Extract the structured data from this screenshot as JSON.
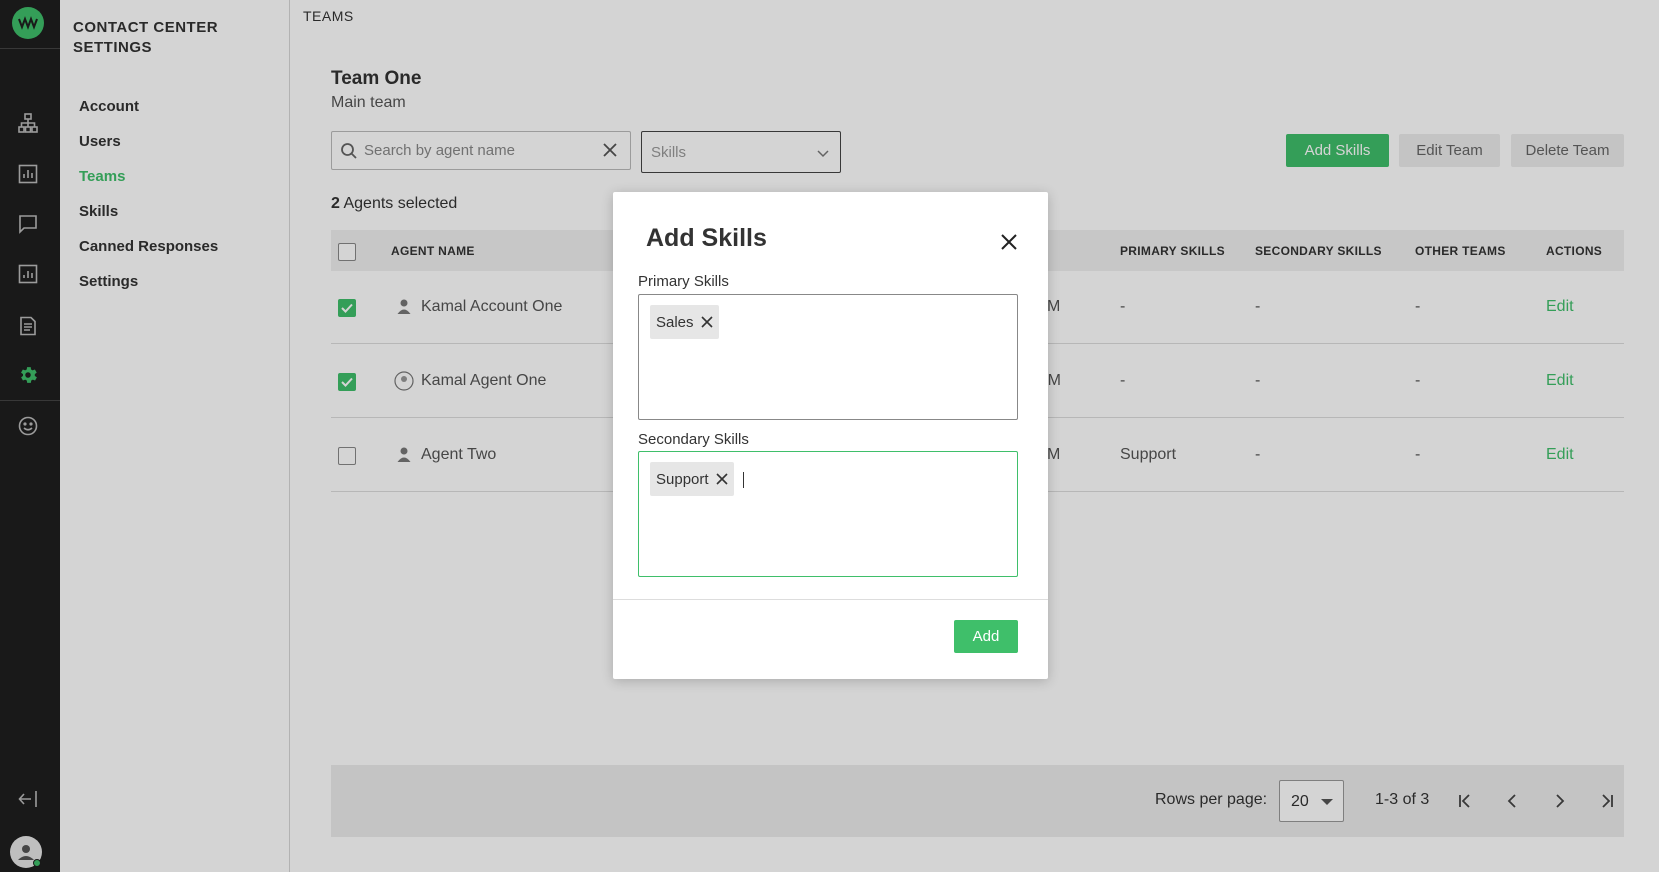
{
  "rail": {
    "icons": [
      "logo-icon",
      "org-chart-icon",
      "reports-icon",
      "chat-icon",
      "analytics-icon",
      "document-icon",
      "settings-gear-icon",
      "smiley-icon",
      "logout-icon",
      "user-avatar-icon"
    ],
    "accent": "#3fbf6a",
    "background": "#1f1f1f"
  },
  "subnav": {
    "title": "CONTACT CENTER SETTINGS",
    "items": [
      {
        "label": "Account",
        "active": false
      },
      {
        "label": "Users",
        "active": false
      },
      {
        "label": "Teams",
        "active": true
      },
      {
        "label": "Skills",
        "active": false
      },
      {
        "label": "Canned Responses",
        "active": false
      },
      {
        "label": "Settings",
        "active": false
      }
    ]
  },
  "header": {
    "breadcrumb": "TEAMS"
  },
  "team": {
    "name": "Team One",
    "description": "Main team"
  },
  "filters": {
    "search_placeholder": "Search by agent name",
    "skills_placeholder": "Skills"
  },
  "actions": {
    "add_skills": "Add Skills",
    "edit_team": "Edit Team",
    "delete_team": "Delete Team"
  },
  "selection": {
    "count": "2",
    "text": "Agents selected"
  },
  "table": {
    "headers": [
      "AGENT NAME",
      "PRIMARY SKILLS",
      "SECONDARY SKILLS",
      "OTHER TEAMS",
      "ACTIONS"
    ],
    "rows": [
      {
        "checked": true,
        "name": "Kamal Account One",
        "time_frag": "M",
        "primary": "-",
        "secondary": "-",
        "other": "-",
        "action": "Edit"
      },
      {
        "checked": true,
        "name": "Kamal Agent One",
        "time_frag": "PM",
        "primary": "-",
        "secondary": "-",
        "other": "-",
        "action": "Edit"
      },
      {
        "checked": false,
        "name": "Agent Two",
        "time_frag": "M",
        "primary": "Support",
        "secondary": "-",
        "other": "-",
        "action": "Edit"
      }
    ]
  },
  "pager": {
    "rows_label": "Rows per page:",
    "rows_value": "20",
    "range": "1-3 of 3"
  },
  "modal": {
    "title": "Add Skills",
    "primary_label": "Primary Skills",
    "primary_chips": [
      "Sales"
    ],
    "secondary_label": "Secondary Skills",
    "secondary_chips": [
      "Support"
    ],
    "add_button": "Add"
  }
}
